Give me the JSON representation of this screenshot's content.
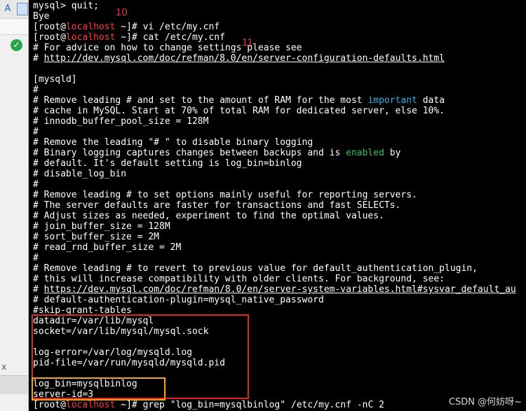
{
  "left_panel": {
    "icon_a": "A",
    "icon_check": "✓",
    "marker": "x"
  },
  "terminal": {
    "lines": [
      {
        "id": "l0",
        "text": "mysql> quit;"
      },
      {
        "id": "l1",
        "text": "Bye"
      },
      {
        "id": "l2",
        "prompt_pre": "[root@",
        "prompt_host": "localhost",
        "prompt_post": " ~]# ",
        "cmd": "vi /etc/my.cnf"
      },
      {
        "id": "l3",
        "prompt_pre": "[root@",
        "prompt_host": "localhost",
        "prompt_post": " ~]# ",
        "cmd": "cat /etc/my.cnf"
      },
      {
        "id": "l4",
        "text": "# For advice on how to change settings please see"
      },
      {
        "id": "l5",
        "prefix": "# ",
        "link": "http://dev.mysql.com/doc/refman/8.0/en/server-configuration-defaults.html"
      },
      {
        "id": "l6",
        "text": ""
      },
      {
        "id": "l7",
        "text": "[mysqld]"
      },
      {
        "id": "l8",
        "text": "#"
      },
      {
        "id": "l9",
        "pre": "# Remove leading # and set to the amount of RAM for the most ",
        "kw": "important",
        "post": " data"
      },
      {
        "id": "l10",
        "text": "# cache in MySQL. Start at 70% of total RAM for dedicated server, else 10%."
      },
      {
        "id": "l11",
        "text": "# innodb_buffer_pool_size = 128M"
      },
      {
        "id": "l12",
        "text": "#"
      },
      {
        "id": "l13",
        "text": "# Remove the leading \"# \" to disable binary logging"
      },
      {
        "id": "l14",
        "pre": "# Binary logging captures changes between backups and is ",
        "kw": "enabled",
        "post": " by"
      },
      {
        "id": "l15",
        "text": "# default. It's default setting is log_bin=binlog"
      },
      {
        "id": "l16",
        "text": "# disable_log_bin"
      },
      {
        "id": "l17",
        "text": "#"
      },
      {
        "id": "l18",
        "text": "# Remove leading # to set options mainly useful for reporting servers."
      },
      {
        "id": "l19",
        "text": "# The server defaults are faster for transactions and fast SELECTs."
      },
      {
        "id": "l20",
        "text": "# Adjust sizes as needed, experiment to find the optimal values."
      },
      {
        "id": "l21",
        "text": "# join_buffer_size = 128M"
      },
      {
        "id": "l22",
        "text": "# sort_buffer_size = 2M"
      },
      {
        "id": "l23",
        "text": "# read_rnd_buffer_size = 2M"
      },
      {
        "id": "l24",
        "text": "#"
      },
      {
        "id": "l25",
        "text": "# Remove leading # to revert to previous value for default_authentication_plugin,"
      },
      {
        "id": "l26",
        "text": "# this will increase compatibility with older clients. For background, see:"
      },
      {
        "id": "l27",
        "prefix": "# ",
        "link": "https://dev.mysql.com/doc/refman/8.0/en/server-system-variables.html#sysvar_default_au"
      },
      {
        "id": "l28",
        "text": "# default-authentication-plugin=mysql_native_password"
      },
      {
        "id": "l29",
        "text": "#skip-grant-tables"
      },
      {
        "id": "l30",
        "text": "datadir=/var/lib/mysql"
      },
      {
        "id": "l31",
        "text": "socket=/var/lib/mysql/mysql.sock"
      },
      {
        "id": "l32",
        "text": ""
      },
      {
        "id": "l33",
        "text": "log-error=/var/log/mysqld.log"
      },
      {
        "id": "l34",
        "text": "pid-file=/var/run/mysqld/mysqld.pid"
      },
      {
        "id": "l35",
        "text": ""
      },
      {
        "id": "l36",
        "text": "log_bin=mysqlbinlog"
      },
      {
        "id": "l37",
        "text": "server-id=3"
      },
      {
        "id": "l38",
        "prompt_pre": "[root@",
        "prompt_host": "localhost",
        "prompt_post": " ~]# ",
        "cmd": "grep \"log_bin=mysqlbinlog\" /etc/my.cnf -nC 2"
      }
    ]
  },
  "annotations": {
    "num_10": "10",
    "num_11": "11"
  },
  "watermark": "CSDN @何妨呀~",
  "colors": {
    "host": "#ff3b3b",
    "keyword_blue": "#2fb3e8",
    "keyword_green": "#34c15a",
    "red_box": "#e02424",
    "orange_box": "#f5a623"
  }
}
